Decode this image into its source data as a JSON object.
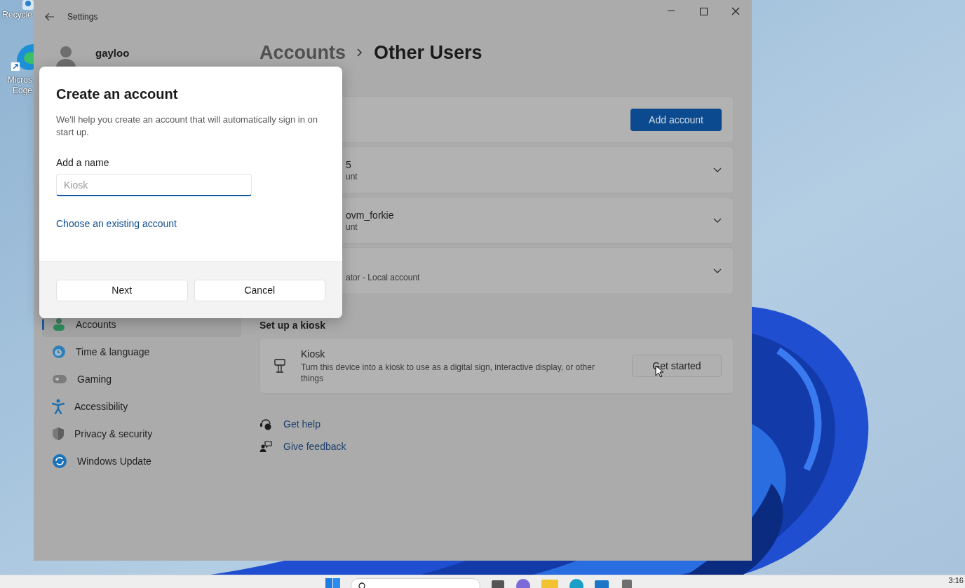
{
  "desktop_icons": [
    {
      "kind": "recycle",
      "label_lines": [
        "Recycle"
      ]
    },
    {
      "kind": "edge",
      "label_lines": [
        "Micros",
        "Edge"
      ]
    }
  ],
  "window": {
    "title": "Settings"
  },
  "profile": {
    "name": "gayloo"
  },
  "sidebar": {
    "items": [
      {
        "kind": "accounts",
        "label": "Accounts",
        "selected": true
      },
      {
        "kind": "time",
        "label": "Time & language",
        "selected": false
      },
      {
        "kind": "gaming",
        "label": "Gaming",
        "selected": false
      },
      {
        "kind": "accessibility",
        "label": "Accessibility",
        "selected": false
      },
      {
        "kind": "privacy",
        "label": "Privacy & security",
        "selected": false
      },
      {
        "kind": "update",
        "label": "Windows Update",
        "selected": false
      }
    ]
  },
  "breadcrumb": {
    "parent": "Accounts",
    "current": "Other Users"
  },
  "add_account_button": "Add account",
  "accounts": [
    {
      "name": "5",
      "type": "unt"
    },
    {
      "name": "ovm_forkie",
      "type": "unt"
    },
    {
      "type": "ator - Local account"
    }
  ],
  "kiosk_section": {
    "heading": "Set up a kiosk",
    "title": "Kiosk",
    "description": "Turn this device into a kiosk to use as a digital sign, interactive display, or other things",
    "button": "Get started"
  },
  "links": [
    {
      "kind": "help",
      "label": "Get help"
    },
    {
      "kind": "feedback",
      "label": "Give feedback"
    }
  ],
  "dialog": {
    "title": "Create an account",
    "description": "We'll help you create an account that will automatically sign in on start up.",
    "field_label": "Add a name",
    "field": {
      "placeholder": "Kiosk"
    },
    "link": "Choose an existing account",
    "buttons": [
      "Next",
      "Cancel"
    ]
  },
  "taskbar": {
    "clock": "3:16"
  }
}
